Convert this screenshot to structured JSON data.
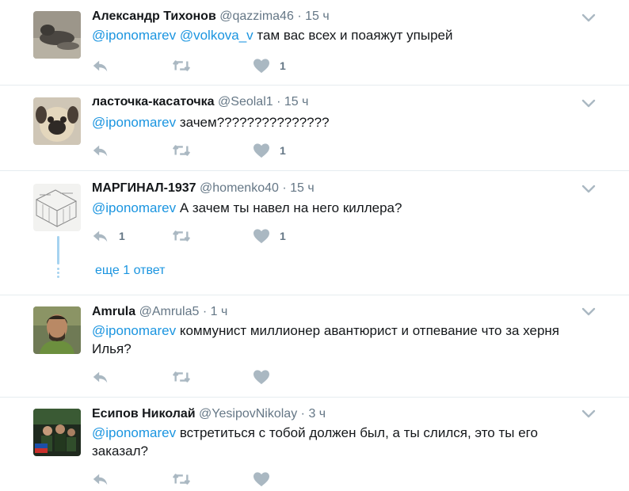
{
  "tweets": [
    {
      "name": "Александр Тихонов",
      "handle": "@qazzima46",
      "dot": "·",
      "time": "15 ч",
      "mentions": [
        "@iponomarev",
        "@volkova_v"
      ],
      "text": "там вас всех и поаяжут упырей",
      "reply_count": "",
      "like_count": "1"
    },
    {
      "name": "ласточка-касаточка",
      "handle": "@Seolal1",
      "dot": "·",
      "time": "15 ч",
      "mentions": [
        "@iponomarev"
      ],
      "text": "зачем???????????????",
      "reply_count": "",
      "like_count": "1"
    },
    {
      "name": "МАРГИНАЛ-1937",
      "handle": "@homenko40",
      "dot": "·",
      "time": "15 ч",
      "mentions": [
        "@iponomarev"
      ],
      "text": "А зачем ты навел на него киллера?",
      "reply_count": "1",
      "like_count": "1",
      "more_replies": "еще 1 ответ"
    },
    {
      "name": "Amrula",
      "handle": "@Amrula5",
      "dot": "·",
      "time": "1 ч",
      "mentions": [
        "@iponomarev"
      ],
      "text_line1": "коммунист миллионер авантюрист и отпевание что за херня",
      "text_line2": "Илья?",
      "reply_count": "",
      "like_count": ""
    },
    {
      "name": "Есипов Николай",
      "handle": "@YesipovNikolay",
      "dot": "·",
      "time": "3 ч",
      "mentions": [
        "@iponomarev"
      ],
      "text_line1": "встретиться с тобой должен был, а ты слился, это ты его",
      "text_line2": "заказал?",
      "reply_count": "",
      "like_count": ""
    }
  ],
  "colors": {
    "accent": "#1b95e0",
    "muted": "#657786",
    "icon": "#aab8c2",
    "text": "#14171a"
  },
  "icons": [
    "reply-icon",
    "retweet-icon",
    "like-icon",
    "caret-down-icon"
  ]
}
